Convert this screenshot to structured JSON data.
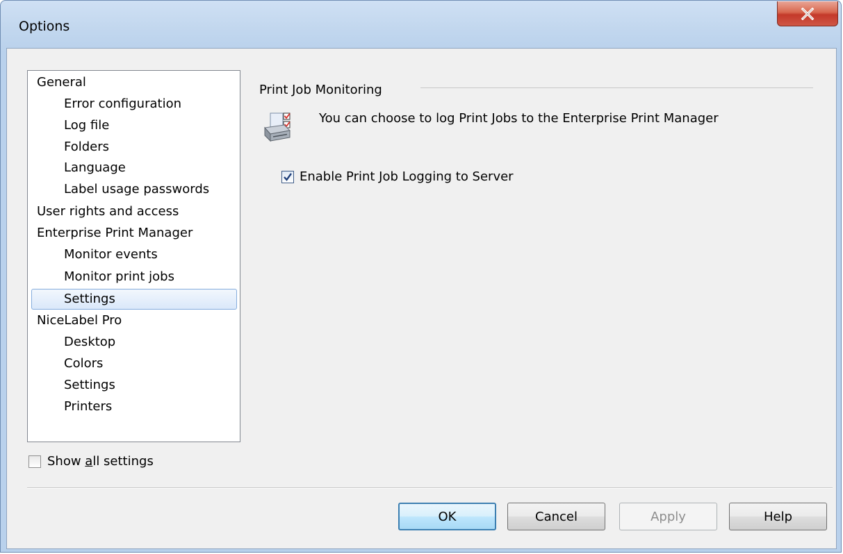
{
  "window": {
    "title": "Options",
    "close_icon": "close-x-icon"
  },
  "sidebar": {
    "items": [
      {
        "label": "General",
        "level": 0
      },
      {
        "label": "Error configuration",
        "level": 1
      },
      {
        "label": "Log file",
        "level": 1
      },
      {
        "label": "Folders",
        "level": 1
      },
      {
        "label": "Language",
        "level": 1
      },
      {
        "label": "Label usage passwords",
        "level": 1
      },
      {
        "label": "User rights and access",
        "level": 0
      },
      {
        "label": "Enterprise Print Manager",
        "level": 0
      },
      {
        "label": "Monitor events",
        "level": 1
      },
      {
        "label": "Monitor print jobs",
        "level": 1,
        "selected": true
      },
      {
        "label": "Settings",
        "level": 1
      },
      {
        "label": "NiceLabel Pro",
        "level": 0
      },
      {
        "label": "Desktop",
        "level": 1
      },
      {
        "label": "Colors",
        "level": 1
      },
      {
        "label": "Settings",
        "level": 1
      },
      {
        "label": "Printers",
        "level": 1
      }
    ],
    "selected_label": "Monitor print jobs"
  },
  "show_all": {
    "label_pre": "Show ",
    "label_accel": "a",
    "label_post": "ll settings",
    "checked": false
  },
  "panel": {
    "group_title": "Print Job Monitoring",
    "icon": "printer-checklist-icon",
    "description": "You can choose to log Print Jobs to the Enterprise Print Manager",
    "enable_logging": {
      "label": "Enable Print Job Logging to Server",
      "checked": true
    }
  },
  "buttons": {
    "ok": "OK",
    "cancel": "Cancel",
    "apply": "Apply",
    "help": "Help"
  },
  "colors": {
    "selection_border": "#84acdd",
    "selection_fill": "#dae8fa",
    "close_button": "#c4392a",
    "default_button_border": "#3c7fb1"
  }
}
